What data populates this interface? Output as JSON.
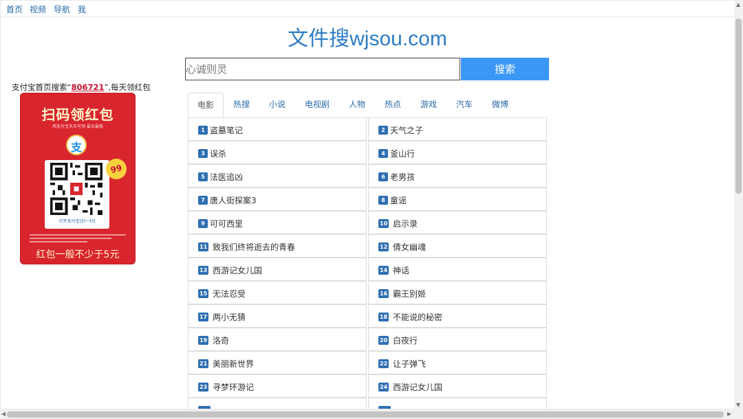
{
  "nav": {
    "home": "首页",
    "video": "视频",
    "navigation": "导航",
    "me": "我"
  },
  "site": {
    "logo_cn": "文件搜",
    "logo_domain": "wjsou.com"
  },
  "search": {
    "placeholder": "心诚则灵",
    "button": "搜索"
  },
  "promo": {
    "prefix": "支付宝首页搜索“",
    "code": "806721",
    "suffix": "”,每天领红包",
    "card_title": "扫码领红包",
    "card_subtitle": "用支付宝天天可领  最日最稳",
    "card_scan_label": "打开支付宝[扫一扫]",
    "badge": "99",
    "card_bottom": "红包一般不少于5元"
  },
  "tabs": [
    "电影",
    "热搜",
    "小说",
    "电视剧",
    "人物",
    "热点",
    "游戏",
    "汽车",
    "微博"
  ],
  "active_tab": 0,
  "list": [
    {
      "n": "1",
      "t": "盗墓笔记"
    },
    {
      "n": "2",
      "t": "天气之子"
    },
    {
      "n": "3",
      "t": "误杀"
    },
    {
      "n": "4",
      "t": "釜山行"
    },
    {
      "n": "5",
      "t": "法医追凶"
    },
    {
      "n": "6",
      "t": "老男孩"
    },
    {
      "n": "7",
      "t": "唐人街探案3"
    },
    {
      "n": "8",
      "t": "童谣"
    },
    {
      "n": "9",
      "t": "可可西里"
    },
    {
      "n": "10",
      "t": "启示录"
    },
    {
      "n": "11",
      "t": "致我们终将逝去的青春"
    },
    {
      "n": "12",
      "t": "倩女幽魂"
    },
    {
      "n": "13",
      "t": "西游记女儿国"
    },
    {
      "n": "14",
      "t": "神话"
    },
    {
      "n": "15",
      "t": "无法忍受"
    },
    {
      "n": "16",
      "t": "霸王别姬"
    },
    {
      "n": "17",
      "t": "两小无猜"
    },
    {
      "n": "18",
      "t": "不能说的秘密"
    },
    {
      "n": "19",
      "t": "洛奇"
    },
    {
      "n": "20",
      "t": "白夜行"
    },
    {
      "n": "21",
      "t": "美丽新世界"
    },
    {
      "n": "22",
      "t": "让子弹飞"
    },
    {
      "n": "23",
      "t": "寻梦环游记"
    },
    {
      "n": "24",
      "t": "西游记女儿国"
    }
  ],
  "colors": {
    "brand": "#2d7cc6",
    "search_button": "#3b97f5",
    "badge": "#2f6fb2",
    "promo_red": "#d9252e"
  }
}
